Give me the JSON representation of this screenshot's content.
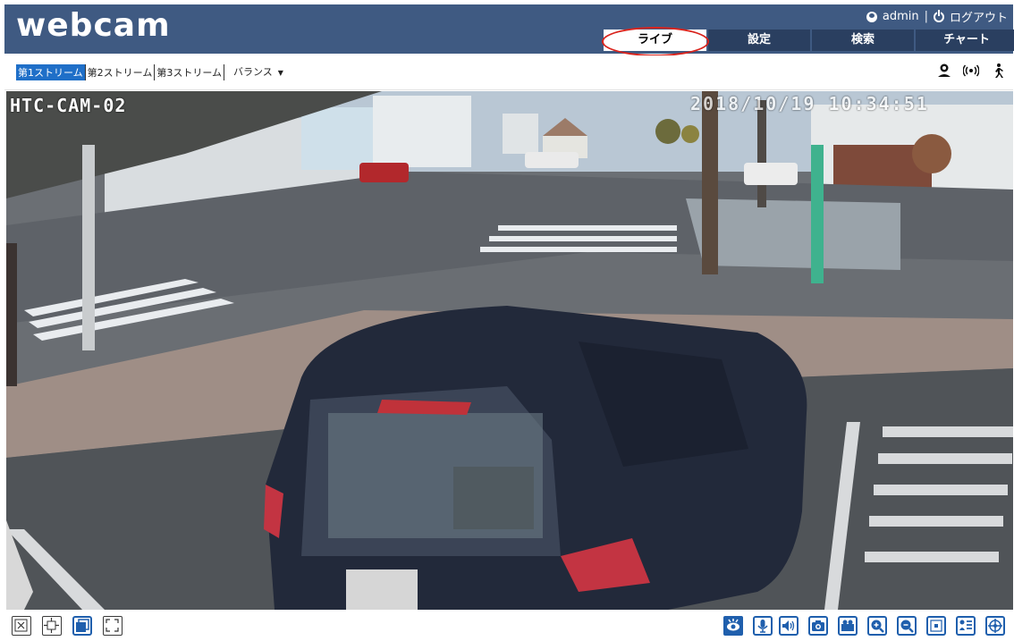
{
  "header": {
    "logo": "webcam",
    "user": "admin",
    "separator": "|",
    "logout": "ログアウト",
    "tabs": [
      {
        "label": "ライブ",
        "active": true
      },
      {
        "label": "設定",
        "active": false
      },
      {
        "label": "検索",
        "active": false
      },
      {
        "label": "チャート",
        "active": false
      }
    ]
  },
  "streambar": {
    "streams": [
      {
        "label": "第1ストリーム",
        "active": true
      },
      {
        "label": "第2ストリーム",
        "active": false
      },
      {
        "label": "第3ストリーム",
        "active": false
      }
    ],
    "balance": "バランス",
    "icons": [
      "person-pin-icon",
      "broadcast-icon",
      "walking-person-icon"
    ]
  },
  "video": {
    "camera_name": "HTC-CAM-02",
    "timestamp": "2018/10/19 10:34:51"
  },
  "bottom_toolbar": {
    "left": [
      "close-window-icon",
      "fit-window-icon",
      "restore-window-icon",
      "fullscreen-icon"
    ],
    "right": [
      "live-view-icon",
      "microphone-icon",
      "speaker-icon",
      "snapshot-icon",
      "record-icon",
      "zoom-in-icon",
      "zoom-out-icon",
      "digital-zoom-icon",
      "stream-info-icon",
      "ptz-icon"
    ]
  },
  "colors": {
    "header_bg": "#3f5a82",
    "tab_bg": "#2a3f60",
    "accent": "#1f6fc8",
    "annotation": "#d9231c"
  }
}
